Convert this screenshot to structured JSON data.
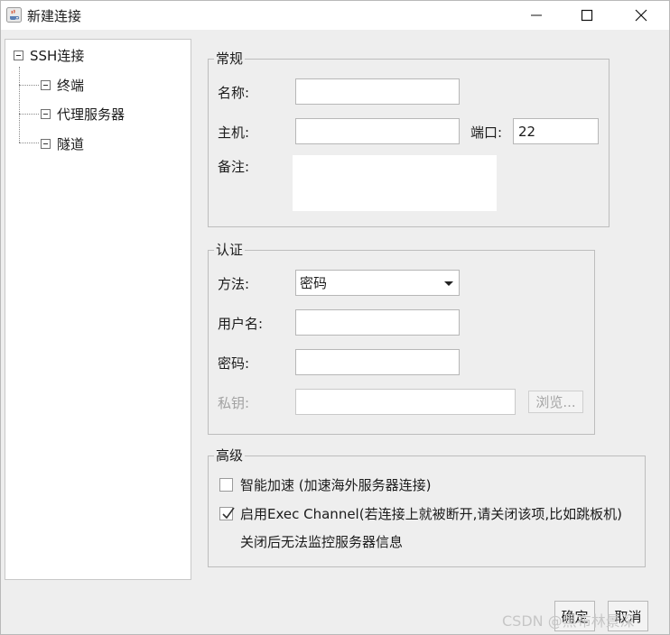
{
  "window": {
    "title": "新建连接",
    "icon": "java-cup-icon",
    "controls": [
      "minimize-icon",
      "maximize-icon",
      "close-icon"
    ]
  },
  "tree": {
    "root": "SSH连接",
    "children": [
      "终端",
      "代理服务器",
      "隧道"
    ]
  },
  "general": {
    "title": "常规",
    "name_label": "名称:",
    "name_value": "",
    "host_label": "主机:",
    "host_value": "",
    "port_label": "端口:",
    "port_value": "22",
    "note_label": "备注:",
    "note_value": ""
  },
  "auth": {
    "title": "认证",
    "method_label": "方法:",
    "method_value": "密码",
    "username_label": "用户名:",
    "username_value": "",
    "password_label": "密码:",
    "password_value": "",
    "privatekey_label": "私钥:",
    "privatekey_value": "",
    "browse_label": "浏览..."
  },
  "advanced": {
    "title": "高级",
    "smart_accel_label": "智能加速 (加速海外服务器连接)",
    "smart_accel_checked": false,
    "exec_channel_label": "启用Exec Channel(若连接上就被断开,请关闭该项,比如跳板机)",
    "exec_channel_checked": true,
    "exec_channel_note": "关闭后无法监控服务器信息"
  },
  "footer": {
    "ok_label": "确定",
    "cancel_label": "取消"
  },
  "watermark": "CSDN @黑布林景深"
}
